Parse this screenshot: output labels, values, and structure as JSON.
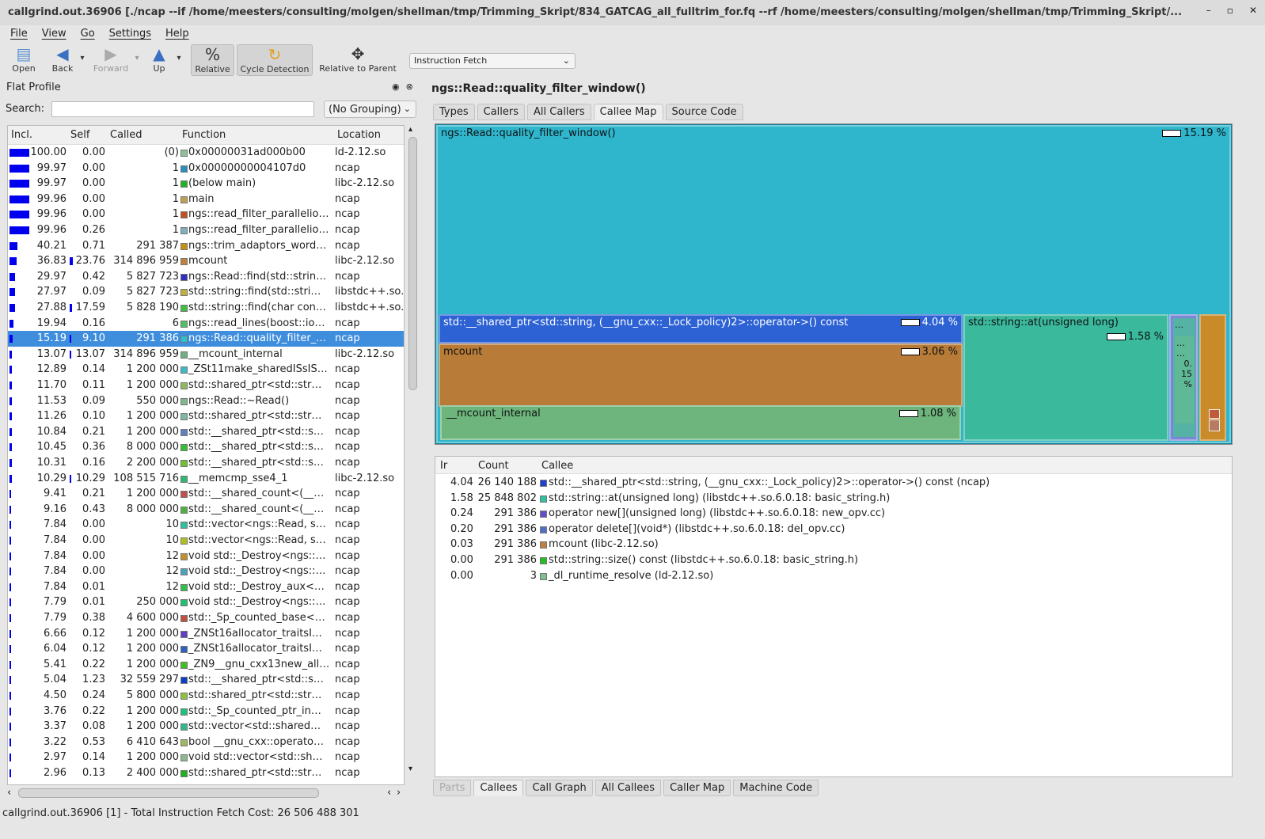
{
  "window": {
    "title": "callgrind.out.36906 [./ncap --if /home/meesters/consulting/molgen/shellman/tmp/Trimming_Skript/834_GATCAG_all_fulltrim_for.fq --rf /home/meesters/consulting/molgen/shellman/tmp/Trimming_Skript/...",
    "min": "–",
    "max": "▫",
    "close": "✕"
  },
  "menu": [
    "File",
    "View",
    "Go",
    "Settings",
    "Help"
  ],
  "toolbar": {
    "open": "Open",
    "back": "Back",
    "forward": "Forward",
    "up": "Up",
    "relative": "Relative",
    "cycle": "Cycle Detection",
    "relparent": "Relative to Parent",
    "cost_type": "Instruction Fetch"
  },
  "flat_profile": {
    "title": "Flat Profile",
    "search_label": "Search:",
    "search_value": "",
    "grouping": "(No Grouping)",
    "columns": {
      "incl": "Incl.",
      "self": "Self",
      "called": "Called",
      "function": "Function",
      "location": "Location"
    },
    "rows": [
      [
        "100.00",
        "0.00",
        "(0)",
        "#8fc09a",
        "0x00000031ad000b00",
        "ld-2.12.so"
      ],
      [
        "99.97",
        "0.00",
        "1",
        "#2a8fc0",
        "0x00000000004107d0",
        "ncap"
      ],
      [
        "99.97",
        "0.00",
        "1",
        "#22b322",
        "(below main)",
        "libc-2.12.so"
      ],
      [
        "99.96",
        "0.00",
        "1",
        "#c0a050",
        "main",
        "ncap"
      ],
      [
        "99.96",
        "0.00",
        "1",
        "#c05020",
        "ngs::read_filter_parallelio…",
        "ncap"
      ],
      [
        "99.96",
        "0.26",
        "1",
        "#80b0c0",
        "ngs::read_filter_parallelio…",
        "ncap"
      ],
      [
        "40.21",
        "0.71",
        "291 387",
        "#c89010",
        "ngs::trim_adaptors_word…",
        "ncap"
      ],
      [
        "36.83",
        "23.76",
        "314 896 959",
        "#c08040",
        "mcount",
        "libc-2.12.so"
      ],
      [
        "29.97",
        "0.42",
        "5 827 723",
        "#3030c0",
        "ngs::Read::find(std::strin…",
        "ncap"
      ],
      [
        "27.97",
        "0.09",
        "5 827 723",
        "#c0b040",
        "std::string::find(std::stri…",
        "libstdc++.so."
      ],
      [
        "27.88",
        "17.59",
        "5 828 190",
        "#40c040",
        "std::string::find(char con…",
        "libstdc++.so."
      ],
      [
        "19.94",
        "0.16",
        "6",
        "#50c060",
        "ngs::read_lines(boost::io…",
        "ncap"
      ],
      [
        "15.19",
        "9.10",
        "291 386",
        "#30c0d0",
        "ngs::Read::quality_filter_…",
        "ncap"
      ],
      [
        "13.07",
        "13.07",
        "314 896 959",
        "#70b080",
        "__mcount_internal",
        "libc-2.12.so"
      ],
      [
        "12.89",
        "0.14",
        "1 200 000",
        "#40b8c8",
        "_ZSt11make_sharedISsIS…",
        "ncap"
      ],
      [
        "11.70",
        "0.11",
        "1 200 000",
        "#90b860",
        "std::shared_ptr<std::str…",
        "ncap"
      ],
      [
        "11.53",
        "0.09",
        "550 000",
        "#80b890",
        "ngs::Read::~Read()",
        "ncap"
      ],
      [
        "11.26",
        "0.10",
        "1 200 000",
        "#80b8a0",
        "std::shared_ptr<std::str…",
        "ncap"
      ],
      [
        "10.84",
        "0.21",
        "1 200 000",
        "#6080c0",
        "std::__shared_ptr<std::s…",
        "ncap"
      ],
      [
        "10.45",
        "0.36",
        "8 000 000",
        "#30c030",
        "std::__shared_ptr<std::s…",
        "ncap"
      ],
      [
        "10.31",
        "0.16",
        "2 200 000",
        "#70c030",
        "std::__shared_ptr<std::s…",
        "ncap"
      ],
      [
        "10.29",
        "10.29",
        "108 515 716",
        "#30b870",
        "__memcmp_sse4_1",
        "libc-2.12.so"
      ],
      [
        "9.41",
        "0.21",
        "1 200 000",
        "#c05050",
        "std::__shared_count<(__…",
        "ncap"
      ],
      [
        "9.16",
        "0.43",
        "8 000 000",
        "#50b040",
        "std::__shared_count<(__…",
        "ncap"
      ],
      [
        "7.84",
        "0.00",
        "10",
        "#30c0a0",
        "std::vector<ngs::Read, s…",
        "ncap"
      ],
      [
        "7.84",
        "0.00",
        "10",
        "#b0c020",
        "std::vector<ngs::Read, s…",
        "ncap"
      ],
      [
        "7.84",
        "0.00",
        "12",
        "#c09030",
        "void std::_Destroy<ngs::…",
        "ncap"
      ],
      [
        "7.84",
        "0.00",
        "12",
        "#50a0c0",
        "void std::_Destroy<ngs::…",
        "ncap"
      ],
      [
        "7.84",
        "0.01",
        "12",
        "#30c050",
        "void std::_Destroy_aux<…",
        "ncap"
      ],
      [
        "7.79",
        "0.01",
        "250 000",
        "#20c070",
        "void std::_Destroy<ngs::…",
        "ncap"
      ],
      [
        "7.79",
        "0.38",
        "4 600 000",
        "#c05040",
        "std::_Sp_counted_base<…",
        "ncap"
      ],
      [
        "6.66",
        "0.12",
        "1 200 000",
        "#6040c0",
        "_ZNSt16allocator_traitsI…",
        "ncap"
      ],
      [
        "6.04",
        "0.12",
        "1 200 000",
        "#3060c0",
        "_ZNSt16allocator_traitsI…",
        "ncap"
      ],
      [
        "5.41",
        "0.22",
        "1 200 000",
        "#40c020",
        "_ZN9__gnu_cxx13new_all…",
        "ncap"
      ],
      [
        "5.04",
        "1.23",
        "32 559 297",
        "#1040c0",
        "std::__shared_ptr<std::s…",
        "ncap"
      ],
      [
        "4.50",
        "0.24",
        "5 800 000",
        "#90c040",
        "std::shared_ptr<std::str…",
        "ncap"
      ],
      [
        "3.76",
        "0.22",
        "1 200 000",
        "#20c080",
        "std::_Sp_counted_ptr_in…",
        "ncap"
      ],
      [
        "3.37",
        "0.08",
        "1 200 000",
        "#30b890",
        "std::vector<std::shared…",
        "ncap"
      ],
      [
        "3.22",
        "0.53",
        "6 410 643",
        "#a0b860",
        "bool __gnu_cxx::operato…",
        "ncap"
      ],
      [
        "2.97",
        "0.14",
        "1 200 000",
        "#90b890",
        "void std::vector<std::sh…",
        "ncap"
      ],
      [
        "2.96",
        "0.13",
        "2 400 000",
        "#20b020",
        "std::shared_ptr<std::str…",
        "ncap"
      ]
    ],
    "selected_index": 12
  },
  "status": "callgrind.out.36906 [1] - Total Instruction Fetch Cost:  26 506 488 301",
  "detail": {
    "function": "ngs::Read::quality_filter_window()",
    "top_tabs": [
      "Types",
      "Callers",
      "All Callers",
      "Callee Map",
      "Source Code"
    ],
    "top_active": 3,
    "bottom_tabs": [
      "Parts",
      "Callees",
      "Call Graph",
      "All Callees",
      "Caller Map",
      "Machine Code"
    ],
    "bottom_active": 1,
    "treemap": {
      "root": {
        "label": "ngs::Read::quality_filter_window()",
        "pct": "15.19 %",
        "color": "#2fb6cd"
      },
      "shared": {
        "label": "std::__shared_ptr<std::string, (__gnu_cxx::_Lock_policy)2>::operator->() const",
        "pct": "4.04 %",
        "color": "#2d62d4"
      },
      "mcount": {
        "label": "mcount",
        "pct": "3.06 %",
        "color": "#b87b38"
      },
      "mcount_internal": {
        "label": "__mcount_internal",
        "pct": "1.08 %",
        "color": "#6db57c"
      },
      "at": {
        "label": "std::string::at(unsigned long)",
        "pct": "1.58 %",
        "color": "#3ab99d"
      },
      "small": {
        "l1": "…",
        "l2": "…",
        "l3": "…",
        "pct": "0. 15 %"
      }
    },
    "callees": {
      "columns": {
        "ir": "Ir",
        "count": "Count",
        "callee": "Callee"
      },
      "rows": [
        [
          "4.04",
          "26 140 188",
          "#2040d0",
          "std::__shared_ptr<std::string, (__gnu_cxx::_Lock_policy)2>::operator->() const (ncap)"
        ],
        [
          "1.58",
          "25 848 802",
          "#30c0a0",
          "std::string::at(unsigned long) (libstdc++.so.6.0.18: basic_string.h)"
        ],
        [
          "0.24",
          "291 386",
          "#6050c8",
          "operator new[](unsigned long) (libstdc++.so.6.0.18: new_opv.cc)"
        ],
        [
          "0.20",
          "291 386",
          "#5070c8",
          "operator delete[](void*) (libstdc++.so.6.0.18: del_opv.cc)"
        ],
        [
          "0.03",
          "291 386",
          "#c08040",
          "mcount (libc-2.12.so)"
        ],
        [
          "0.00",
          "291 386",
          "#20c020",
          "std::string::size() const (libstdc++.so.6.0.18: basic_string.h)"
        ],
        [
          "0.00",
          "3",
          "#80c090",
          "_dl_runtime_resolve (ld-2.12.so)"
        ]
      ]
    }
  }
}
